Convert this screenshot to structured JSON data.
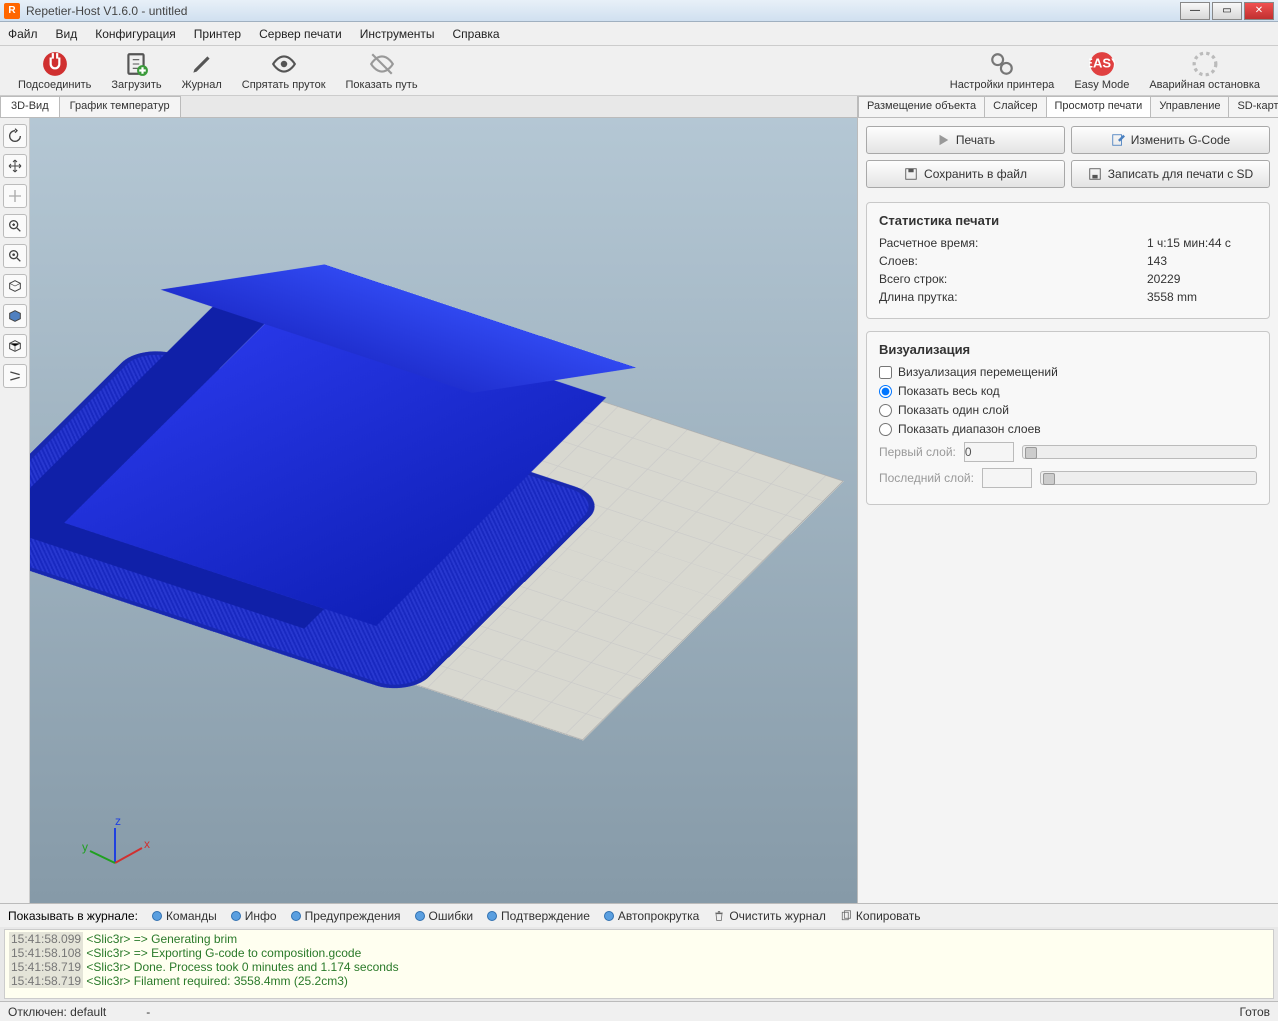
{
  "window": {
    "title": "Repetier-Host V1.6.0 - untitled"
  },
  "menu": {
    "file": "Файл",
    "view": "Вид",
    "config": "Конфигурация",
    "printer": "Принтер",
    "printserver": "Сервер печати",
    "tools": "Инструменты",
    "help": "Справка"
  },
  "toolbar": {
    "connect": "Подсоединить",
    "load": "Загрузить",
    "log": "Журнал",
    "hidefilament": "Спрятать пруток",
    "showpath": "Показать путь",
    "printersettings": "Настройки принтера",
    "easymode": "Easy Mode",
    "emergency": "Аварийная остановка"
  },
  "lefttabs": {
    "view3d": "3D-Вид",
    "tempgraph": "График температур"
  },
  "righttabs": {
    "placement": "Размещение объекта",
    "slicer": "Слайсер",
    "preview": "Просмотр печати",
    "control": "Управление",
    "sdcard": "SD-карта"
  },
  "rbuttons": {
    "print": "Печать",
    "editgcode": "Изменить G-Code",
    "savefile": "Сохранить в файл",
    "writesd": "Записать для печати с SD"
  },
  "stats": {
    "title": "Статистика печати",
    "time_k": "Расчетное время:",
    "time_v": "1 ч:15 мин:44 с",
    "layers_k": "Слоев:",
    "layers_v": "143",
    "lines_k": "Всего строк:",
    "lines_v": "20229",
    "filament_k": "Длина прутка:",
    "filament_v": "3558 mm"
  },
  "vis": {
    "title": "Визуализация",
    "travel": "Визуализация перемещений",
    "allcode": "Показать весь код",
    "onelayer": "Показать один слой",
    "rangelayers": "Показать диапазон слоев",
    "firstlayer": "Первый слой:",
    "firstlayer_v": "0",
    "lastlayer": "Последний слой:"
  },
  "logfilter": {
    "label": "Показывать в журнале:",
    "cmds": "Команды",
    "info": "Инфо",
    "warn": "Предупреждения",
    "err": "Ошибки",
    "ack": "Подтверждение",
    "autoscroll": "Автопрокрутка",
    "clear": "Очистить журнал",
    "copy": "Копировать"
  },
  "console": [
    {
      "ts": "15:41:58.099",
      "msg": "<Slic3r> => Generating brim"
    },
    {
      "ts": "15:41:58.108",
      "msg": "<Slic3r> => Exporting G-code to composition.gcode"
    },
    {
      "ts": "15:41:58.719",
      "msg": "<Slic3r> Done. Process took 0 minutes and 1.174 seconds"
    },
    {
      "ts": "15:41:58.719",
      "msg": "<Slic3r> Filament required: 3558.4mm (25.2cm3)"
    }
  ],
  "status": {
    "left": "Отключен: default",
    "mid": "-",
    "right": "Готов"
  }
}
